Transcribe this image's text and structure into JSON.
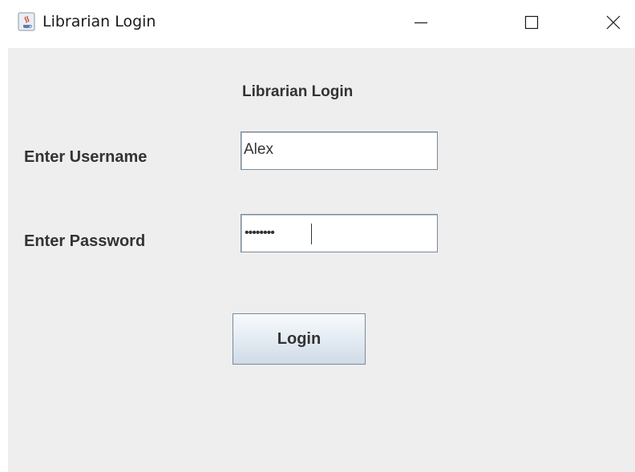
{
  "window": {
    "title": "Librarian Login",
    "icon": "java-cup-icon"
  },
  "form": {
    "heading": "Librarian Login",
    "username_label": "Enter Username",
    "username_value": "Alex",
    "password_label": "Enter Password",
    "password_masked": "••••••••",
    "login_label": "Login"
  },
  "colors": {
    "panel_background": "#eeeeee",
    "text": "#333333",
    "field_border": "#7a8a99"
  }
}
